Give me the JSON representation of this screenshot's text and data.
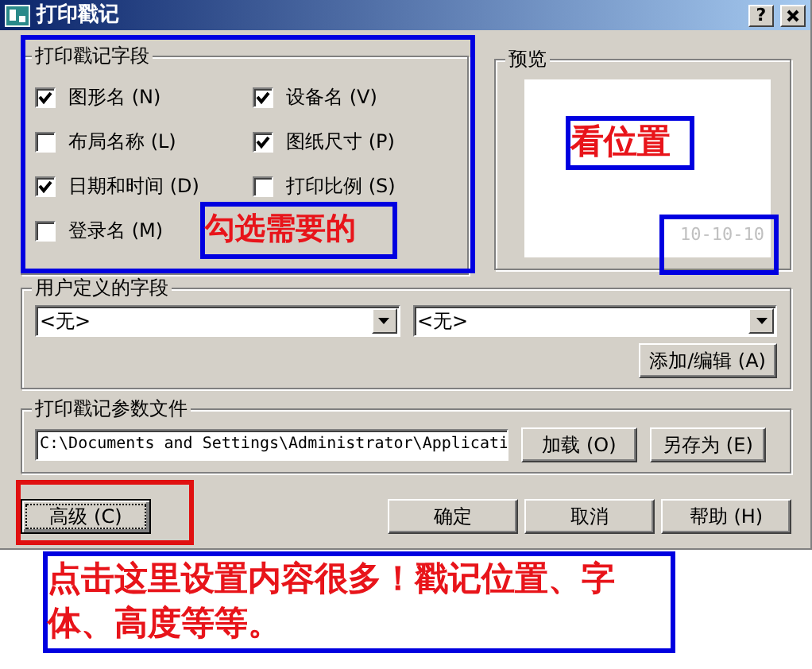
{
  "window": {
    "title": "打印戳记",
    "help_button": "?"
  },
  "fields_group": {
    "title": "打印戳记字段",
    "items": [
      {
        "label": "图形名 (N)",
        "checked": true
      },
      {
        "label": "设备名 (V)",
        "checked": true
      },
      {
        "label": "布局名称 (L)",
        "checked": false
      },
      {
        "label": "图纸尺寸 (P)",
        "checked": true
      },
      {
        "label": "日期和时间 (D)",
        "checked": true
      },
      {
        "label": "打印比例 (S)",
        "checked": false
      },
      {
        "label": "登录名 (M)",
        "checked": false
      }
    ]
  },
  "preview_group": {
    "title": "预览",
    "stamp_text": "10-10-10"
  },
  "custom_group": {
    "title": "用户定义的字段",
    "selects": [
      "<无>",
      "<无>"
    ],
    "button": "添加/编辑 (A)"
  },
  "file_group": {
    "title": "打印戳记参数文件",
    "path": "C:\\Documents and Settings\\Administrator\\Applicati",
    "buttons": [
      "加载 (O)",
      "另存为 (E)"
    ]
  },
  "footer_buttons": [
    {
      "label": "高级 (C)",
      "focused": true
    },
    {
      "label": "确定",
      "focused": false
    },
    {
      "label": "取消",
      "focused": false
    },
    {
      "label": "帮助 (H)",
      "focused": false
    }
  ],
  "annotations": {
    "fields_note": "勾选需要的",
    "preview_note": "看位置",
    "bottom_note": "点击这里设置内容很多！戳记位置、字体、高度等等。"
  }
}
